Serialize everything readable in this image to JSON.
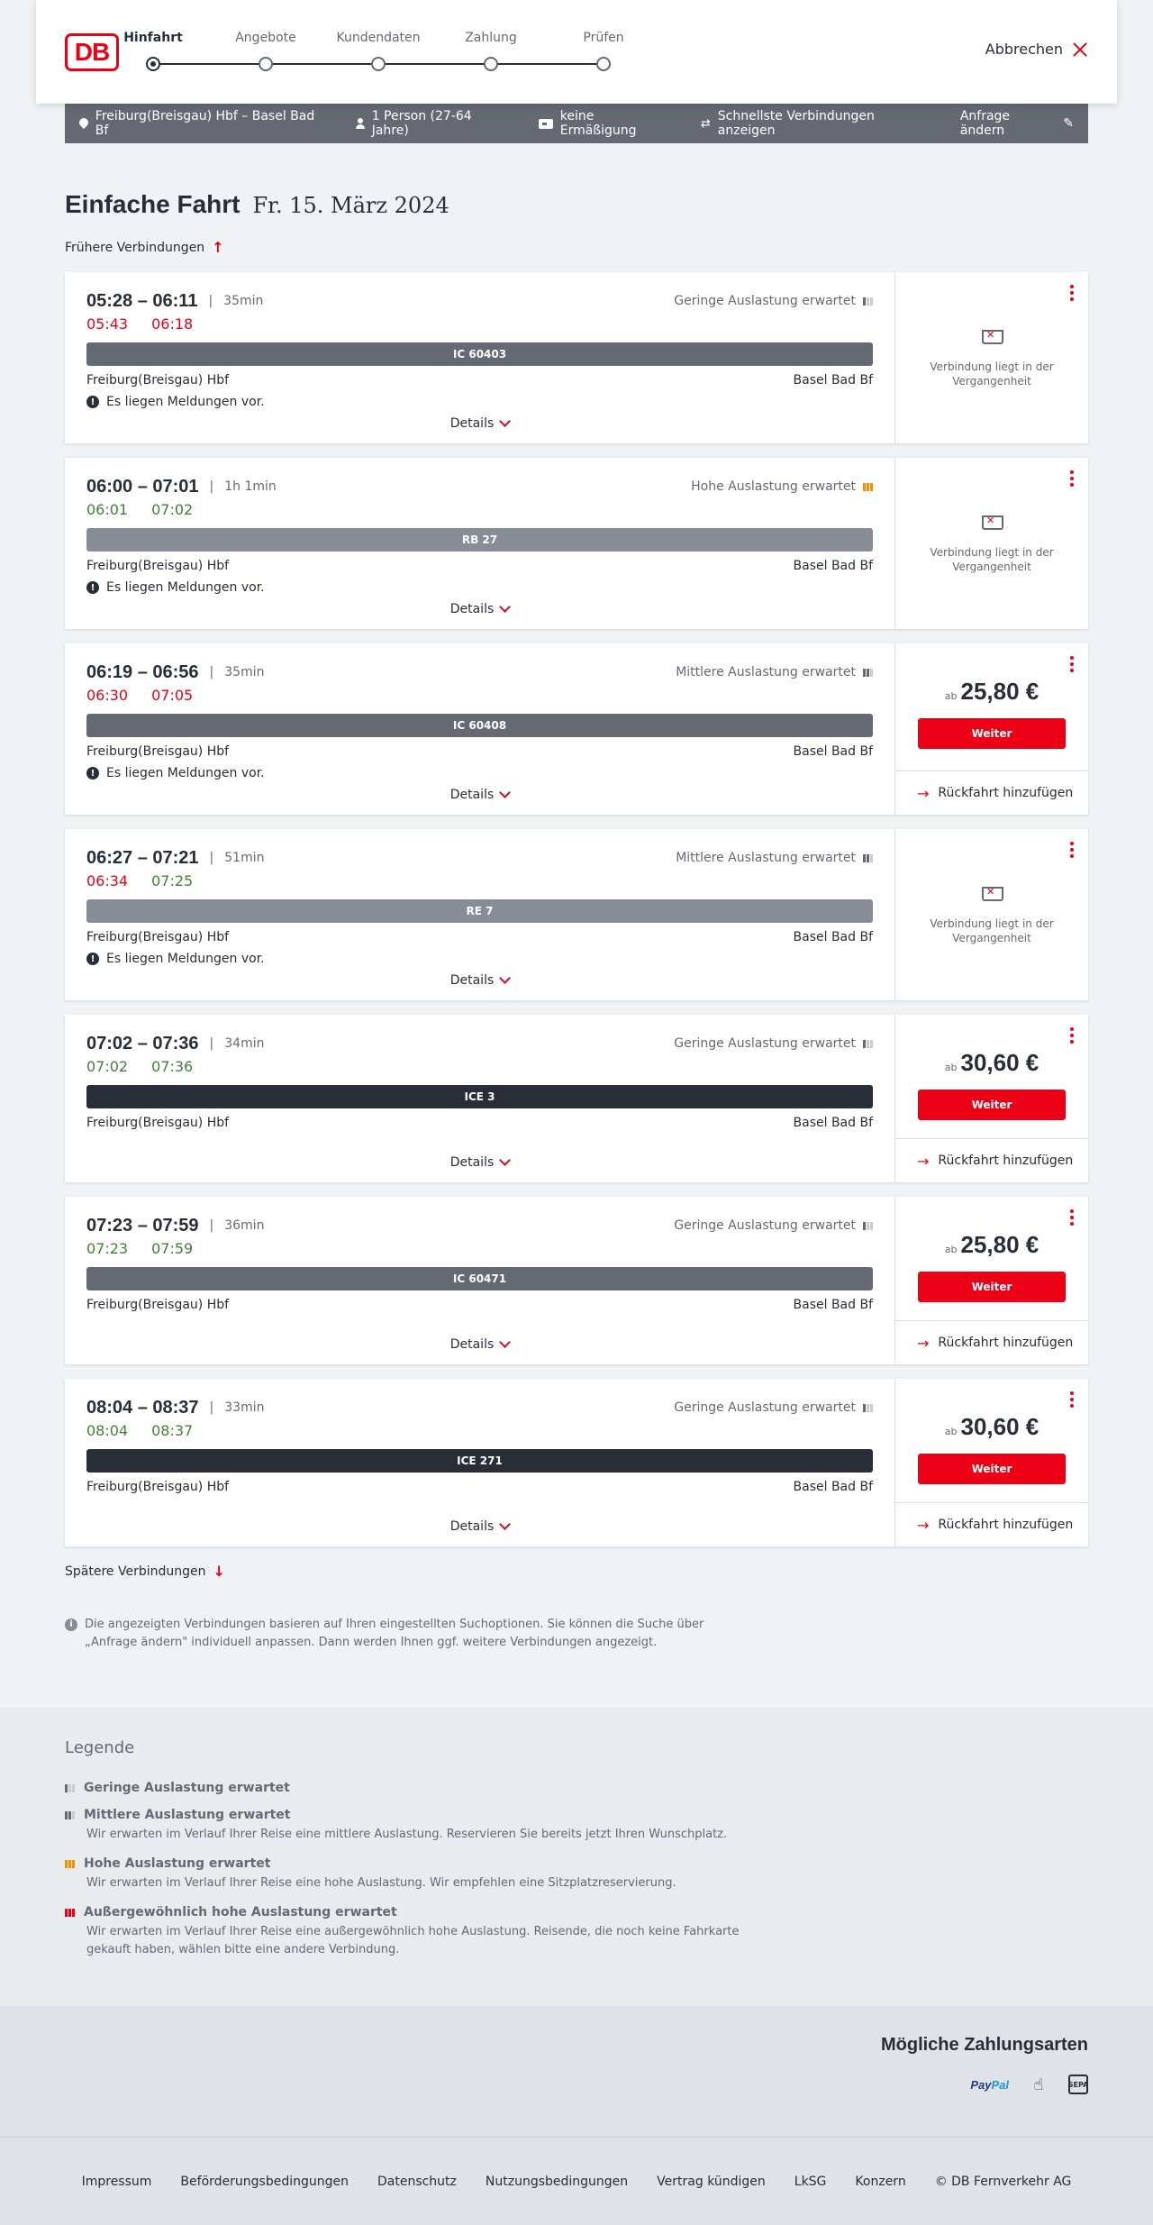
{
  "header": {
    "logo": "DB",
    "steps": [
      "Hinfahrt",
      "Angebote",
      "Kundendaten",
      "Zahlung",
      "Prüfen"
    ],
    "cancel_label": "Abbrechen"
  },
  "query": {
    "route": "Freiburg(Breisgau) Hbf – Basel Bad Bf",
    "passengers": "1 Person (27-64 Jahre)",
    "discount": "keine Ermäßigung",
    "fastest": "Schnellste Verbindungen anzeigen",
    "change": "Anfrage ändern"
  },
  "page": {
    "title": "Einfache Fahrt",
    "date": "Fr. 15. März 2024",
    "earlier": "Frühere Verbindungen",
    "later": "Spätere Verbindungen",
    "details_label": "Details",
    "buy_label": "Weiter",
    "return_label": "Rückfahrt hinzufügen",
    "past_label": "Verbindung liegt in der Vergangenheit",
    "price_prefix": "ab",
    "info": "Die angezeigten Verbindungen basieren auf Ihren eingestellten Suchoptionen. Sie können die Suche über „Anfrage ändern\" individuell anpassen. Dann werden Ihnen ggf. weitere Verbindungen angezeigt."
  },
  "connections": [
    {
      "times": "05:28 – 06:11",
      "duration": "35min",
      "load": "Geringe Auslastung erwartet",
      "rt_dep": "05:43",
      "rt_arr": "06:18",
      "rt_class": "red",
      "train": "IC 60403",
      "from": "Freiburg(Breisgau) Hbf",
      "to": "Basel Bad Bf",
      "message": "Es liegen Meldungen vor.",
      "price": ""
    },
    {
      "times": "06:00 – 07:01",
      "duration": "1h 1min",
      "load": "Hohe Auslastung erwartet",
      "rt_dep": "06:01",
      "rt_arr": "07:02",
      "rt_class": "green",
      "train": "RB 27",
      "from": "Freiburg(Breisgau) Hbf",
      "to": "Basel Bad Bf",
      "message": "Es liegen Meldungen vor.",
      "price": ""
    },
    {
      "times": "06:19 – 06:56",
      "duration": "35min",
      "load": "Mittlere Auslastung erwartet",
      "rt_dep": "06:30",
      "rt_arr": "07:05",
      "rt_class": "red",
      "train": "IC 60408",
      "from": "Freiburg(Breisgau) Hbf",
      "to": "Basel Bad Bf",
      "message": "Es liegen Meldungen vor.",
      "price": "25,80 €"
    },
    {
      "times": "06:27 – 07:21",
      "duration": "51min",
      "load": "Mittlere Auslastung erwartet",
      "rt_dep": "06:34",
      "rt_arr": "07:25",
      "rt_class": "mixed",
      "train": "RE 7",
      "from": "Freiburg(Breisgau) Hbf",
      "to": "Basel Bad Bf",
      "message": "Es liegen Meldungen vor.",
      "price": ""
    },
    {
      "times": "07:02 – 07:36",
      "duration": "34min",
      "load": "Geringe Auslastung erwartet",
      "rt_dep": "07:02",
      "rt_arr": "07:36",
      "rt_class": "green",
      "train": "ICE 3",
      "from": "Freiburg(Breisgau) Hbf",
      "to": "Basel Bad Bf",
      "message": "",
      "price": "30,60 €"
    },
    {
      "times": "07:23 – 07:59",
      "duration": "36min",
      "load": "Geringe Auslastung erwartet",
      "rt_dep": "07:23",
      "rt_arr": "07:59",
      "rt_class": "green",
      "train": "IC 60471",
      "from": "Freiburg(Breisgau) Hbf",
      "to": "Basel Bad Bf",
      "message": "",
      "price": "25,80 €"
    },
    {
      "times": "08:04 – 08:37",
      "duration": "33min",
      "load": "Geringe Auslastung erwartet",
      "rt_dep": "08:04",
      "rt_arr": "08:37",
      "rt_class": "green",
      "train": "ICE 271",
      "from": "Freiburg(Breisgau) Hbf",
      "to": "Basel Bad Bf",
      "message": "",
      "price": "30,60 €"
    }
  ],
  "legend": {
    "title": "Legende",
    "items": [
      {
        "title": "Geringe Auslastung erwartet",
        "desc": ""
      },
      {
        "title": "Mittlere Auslastung erwartet",
        "desc": "Wir erwarten im Verlauf Ihrer Reise eine mittlere Auslastung. Reservieren Sie bereits jetzt Ihren Wunschplatz."
      },
      {
        "title": "Hohe Auslastung erwartet",
        "desc": "Wir erwarten im Verlauf Ihrer Reise eine hohe Auslastung. Wir empfehlen eine Sitzplatzreservierung."
      },
      {
        "title": "Außergewöhnlich hohe Auslastung erwartet",
        "desc": "Wir erwarten im Verlauf Ihrer Reise eine außergewöhnlich hohe Auslastung. Reisende, die noch keine Fahrkarte gekauft haben, wählen bitte eine andere Verbindung."
      }
    ]
  },
  "payment": {
    "title": "Mögliche Zahlungsarten",
    "paypal_a": "Pay",
    "paypal_b": "Pal",
    "sepa": "SEPA"
  },
  "footer": [
    "Impressum",
    "Beförderungsbedingungen",
    "Datenschutz",
    "Nutzungsbedingungen",
    "Vertrag kündigen",
    "LkSG",
    "Konzern",
    "© DB Fernverkehr AG"
  ],
  "colors": {
    "primary": "#ec0016",
    "text": "#282d37",
    "delay": "#ec0016",
    "ontime": "#408335",
    "high_load": "#f39200"
  }
}
